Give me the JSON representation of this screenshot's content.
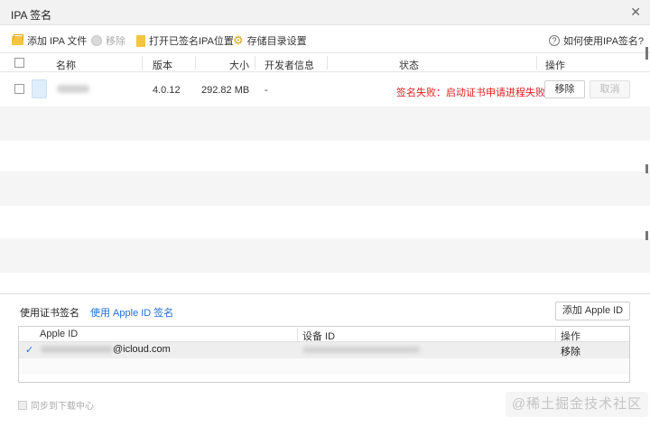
{
  "window": {
    "title": "IPA 签名"
  },
  "toolbar": {
    "add_ipa": "添加 IPA 文件",
    "remove": "移除",
    "open_location": "打开已签名IPA位置",
    "storage_settings": "存储目录设置",
    "help": "如何使用IPA签名?"
  },
  "table": {
    "headers": {
      "name": "名称",
      "version": "版本",
      "size": "大小",
      "developer": "开发者信息",
      "status": "状态",
      "actions": "操作"
    },
    "rows": [
      {
        "version": "4.0.12",
        "size": "292.82 MB",
        "developer": "-",
        "status": "签名失败：启动证书申请进程失败",
        "remove_label": "移除",
        "cancel_label": "取消"
      }
    ]
  },
  "tabs": {
    "cert_sign": "使用证书签名",
    "apple_id_sign": "使用 Apple ID 签名"
  },
  "add_apple_id": "添加 Apple ID",
  "id_table": {
    "headers": {
      "apple_id": "Apple ID",
      "device_id": "设备 ID",
      "actions": "操作"
    },
    "rows": [
      {
        "email_suffix": "@icloud.com",
        "action": "移除",
        "checkmark": "✓"
      }
    ]
  },
  "footer": {
    "sync_label": "同步到下载中心"
  },
  "watermark": "@稀土掘金技术社区",
  "colors": {
    "error": "#e02020",
    "link": "#1e6fd9",
    "folder": "#f5c441"
  }
}
